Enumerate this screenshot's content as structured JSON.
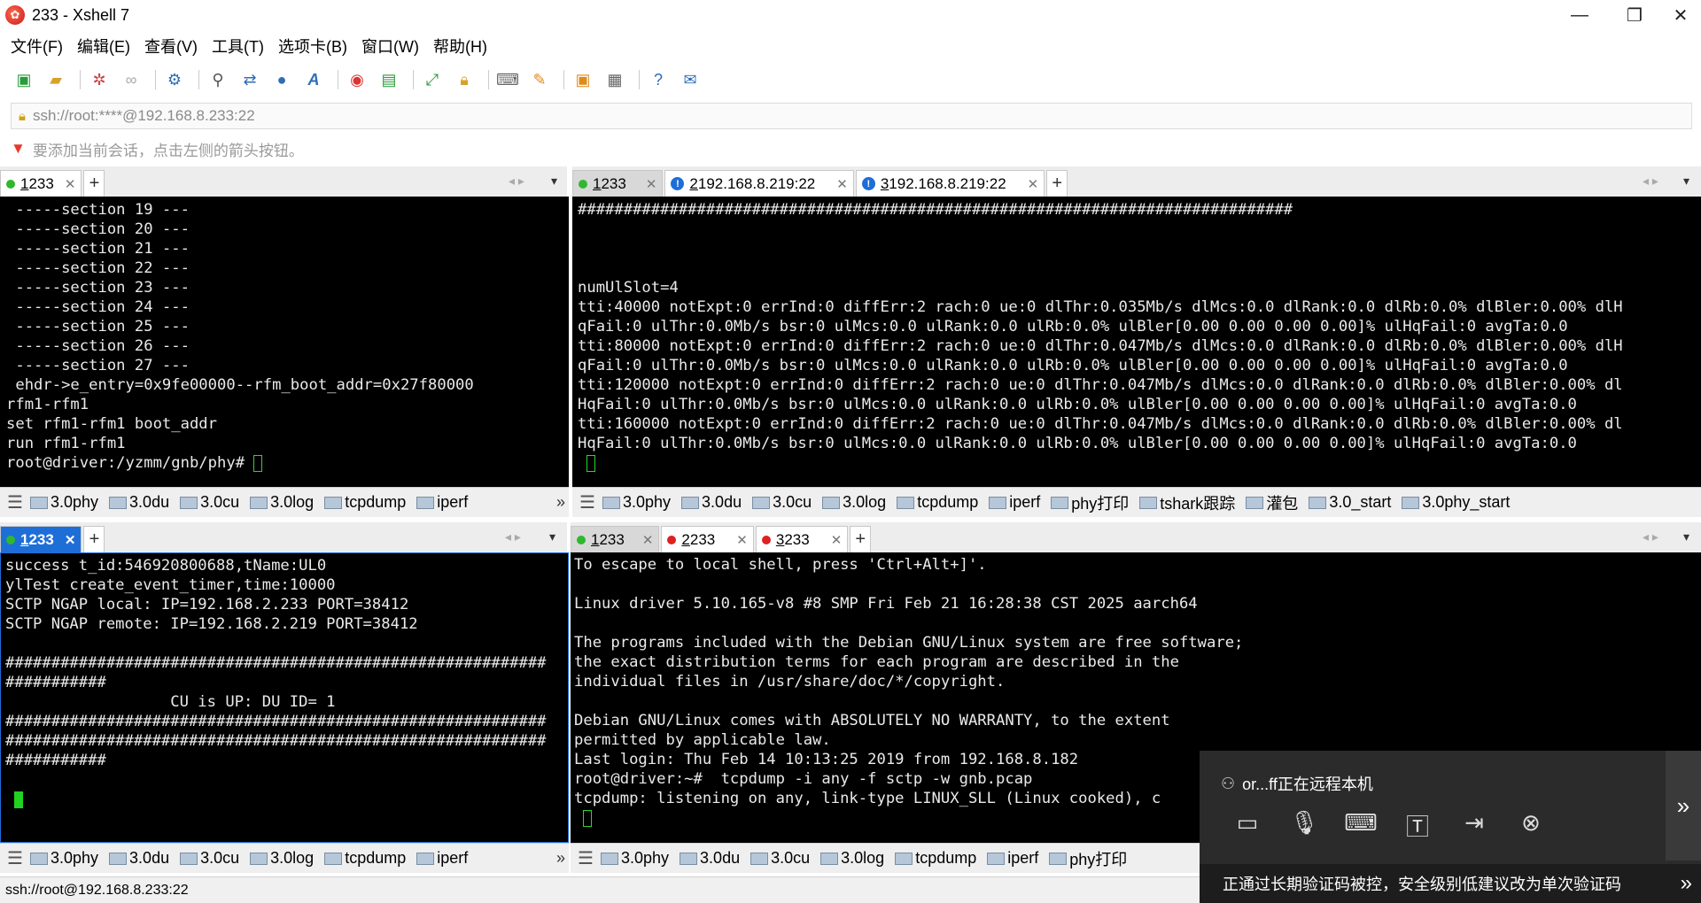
{
  "window": {
    "title": "233 - Xshell 7",
    "minimize": "—",
    "maximize": "❐",
    "close": "✕"
  },
  "menu": [
    "文件(F)",
    "编辑(E)",
    "查看(V)",
    "工具(T)",
    "选项卡(B)",
    "窗口(W)",
    "帮助(H)"
  ],
  "toolbar_icons": [
    "new-session-icon",
    "open-folder-icon",
    "connect-icon",
    "disconnect-icon",
    "properties-icon",
    "find-icon",
    "transfer-icon",
    "globe-icon",
    "font-icon",
    "xftp-icon",
    "script-icon",
    "fullscreen-icon",
    "lock-icon",
    "keyboard-icon",
    "highlight-icon",
    "new-tab-folder-icon",
    "layout-icon",
    "help-icon",
    "chat-icon"
  ],
  "address": {
    "value": "ssh://root:****@192.168.8.233:22"
  },
  "hint": "要添加当前会话，点击左侧的箭头按钮。",
  "panes": {
    "top_left": {
      "tabs": [
        {
          "num": "1",
          "label": " 233",
          "close": "✕",
          "status": "green"
        }
      ],
      "lines": [
        " -----section 19 ---",
        " -----section 20 ---",
        " -----section 21 ---",
        " -----section 22 ---",
        " -----section 23 ---",
        " -----section 24 ---",
        " -----section 25 ---",
        " -----section 26 ---",
        " -----section 27 ---",
        " ehdr->e_entry=0x9fe00000--rfm_boot_addr=0x27f80000",
        "rfm1-rfm1",
        "set rfm1-rfm1 boot_addr",
        "run rfm1-rfm1",
        "root@driver:/yzmm/gnb/phy# "
      ],
      "quick": [
        "3.0phy",
        "3.0du",
        "3.0cu",
        "3.0log",
        "tcpdump",
        "iperf"
      ]
    },
    "top_right": {
      "tabs": [
        {
          "num": "1",
          "label": " 233",
          "close": "✕",
          "status": "green"
        },
        {
          "num": "2",
          "label": " 192.168.8.219:22",
          "close": "✕",
          "status": "info"
        },
        {
          "num": "3",
          "label": " 192.168.8.219:22",
          "close": "✕",
          "status": "info"
        }
      ],
      "lines": [
        "##############################################################################",
        "",
        "",
        "",
        "numUlSlot=4",
        "tti:40000 notExpt:0 errInd:0 diffErr:2 rach:0 ue:0 dlThr:0.035Mb/s dlMcs:0.0 dlRank:0.0 dlRb:0.0% dlBler:0.00% dlH",
        "qFail:0 ulThr:0.0Mb/s bsr:0 ulMcs:0.0 ulRank:0.0 ulRb:0.0% ulBler[0.00 0.00 0.00 0.00]% ulHqFail:0 avgTa:0.0",
        "tti:80000 notExpt:0 errInd:0 diffErr:2 rach:0 ue:0 dlThr:0.047Mb/s dlMcs:0.0 dlRank:0.0 dlRb:0.0% dlBler:0.00% dlH",
        "qFail:0 ulThr:0.0Mb/s bsr:0 ulMcs:0.0 ulRank:0.0 ulRb:0.0% ulBler[0.00 0.00 0.00 0.00]% ulHqFail:0 avgTa:0.0",
        "tti:120000 notExpt:0 errInd:0 diffErr:2 rach:0 ue:0 dlThr:0.047Mb/s dlMcs:0.0 dlRank:0.0 dlRb:0.0% dlBler:0.00% dl",
        "HqFail:0 ulThr:0.0Mb/s bsr:0 ulMcs:0.0 ulRank:0.0 ulRb:0.0% ulBler[0.00 0.00 0.00 0.00]% ulHqFail:0 avgTa:0.0",
        "tti:160000 notExpt:0 errInd:0 diffErr:2 rach:0 ue:0 dlThr:0.047Mb/s dlMcs:0.0 dlRank:0.0 dlRb:0.0% dlBler:0.00% dl",
        "HqFail:0 ulThr:0.0Mb/s bsr:0 ulMcs:0.0 ulRank:0.0 ulRb:0.0% ulBler[0.00 0.00 0.00 0.00]% ulHqFail:0 avgTa:0.0",
        ""
      ],
      "quick": [
        "3.0phy",
        "3.0du",
        "3.0cu",
        "3.0log",
        "tcpdump",
        "iperf",
        "phy打印",
        "tshark跟踪",
        "灌包",
        "3.0_start",
        "3.0phy_start"
      ]
    },
    "bottom_left": {
      "tabs": [
        {
          "num": "1",
          "label": " 233",
          "close": "✕",
          "status": "green"
        }
      ],
      "lines": [
        "success t_id:546920800688,tName:UL0",
        "ylTest create_event_timer,time:10000",
        "SCTP NGAP local: IP=192.168.2.233 PORT=38412",
        "SCTP NGAP remote: IP=192.168.2.219 PORT=38412",
        "",
        "###########################################################",
        "###########",
        "                  CU is UP: DU ID= 1",
        "###########################################################",
        "###########################################################",
        "###########",
        "",
        ""
      ],
      "quick": [
        "3.0phy",
        "3.0du",
        "3.0cu",
        "3.0log",
        "tcpdump",
        "iperf"
      ]
    },
    "bottom_right": {
      "tabs": [
        {
          "num": "1",
          "label": " 233",
          "close": "✕",
          "status": "green"
        },
        {
          "num": "2",
          "label": " 233",
          "close": "✕",
          "status": "red"
        },
        {
          "num": "3",
          "label": " 233",
          "close": "✕",
          "status": "red"
        }
      ],
      "lines": [
        "To escape to local shell, press 'Ctrl+Alt+]'.",
        "",
        "Linux driver 5.10.165-v8 #8 SMP Fri Feb 21 16:28:38 CST 2025 aarch64",
        "",
        "The programs included with the Debian GNU/Linux system are free software;",
        "the exact distribution terms for each program are described in the",
        "individual files in /usr/share/doc/*/copyright.",
        "",
        "Debian GNU/Linux comes with ABSOLUTELY NO WARRANTY, to the extent",
        "permitted by applicable law.",
        "Last login: Thu Feb 14 10:13:25 2019 from 192.168.8.182",
        "root@driver:~#  tcpdump -i any -f sctp -w gnb.pcap",
        "tcpdump: listening on any, link-type LINUX_SLL (Linux cooked), c",
        ""
      ],
      "quick": [
        "3.0phy",
        "3.0du",
        "3.0cu",
        "3.0log",
        "tcpdump",
        "iperf",
        "phy打印"
      ]
    }
  },
  "remote": {
    "who": "or...ff正在远程本机",
    "message": "正通过长期验证码被控，安全级别低建议改为单次验证码",
    "icons": [
      "chat-icon",
      "microphone-icon",
      "keyboard-icon",
      "text-icon",
      "file-transfer-icon",
      "end-session-icon"
    ]
  },
  "status": {
    "connection": "ssh://root@192.168.8.233:22"
  },
  "colors": {
    "terminal_bg": "#000000",
    "terminal_fg": "#eaeaea",
    "cursor": "#21d21f",
    "active_tab": "#1e6ed8"
  }
}
